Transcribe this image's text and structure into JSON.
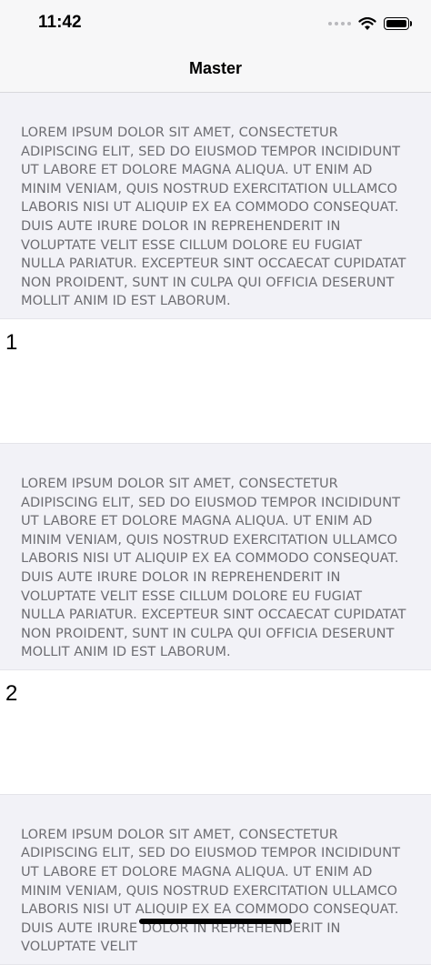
{
  "status": {
    "time": "11:42"
  },
  "nav": {
    "title": "Master"
  },
  "sections": [
    {
      "header": "LOREM IPSUM DOLOR SIT AMET, CONSECTETUR ADIPISCING ELIT, SED DO EIUSMOD TEMPOR INCIDIDUNT UT LABORE ET DOLORE MAGNA ALIQUA. UT ENIM AD MINIM VENIAM, QUIS NOSTRUD EXERCITATION ULLAMCO LABORIS NISI UT ALIQUIP EX EA COMMODO CONSEQUAT. DUIS AUTE IRURE DOLOR IN REPREHENDERIT IN VOLUPTATE VELIT ESSE CILLUM DOLORE EU FUGIAT NULLA PARIATUR. EXCEPTEUR SINT OCCAECAT CUPIDATAT NON PROIDENT, SUNT IN CULPA QUI OFFICIA DESERUNT MOLLIT ANIM ID EST LABORUM.",
      "cell": "1"
    },
    {
      "header": "LOREM IPSUM DOLOR SIT AMET, CONSECTETUR ADIPISCING ELIT, SED DO EIUSMOD TEMPOR INCIDIDUNT UT LABORE ET DOLORE MAGNA ALIQUA. UT ENIM AD MINIM VENIAM, QUIS NOSTRUD EXERCITATION ULLAMCO LABORIS NISI UT ALIQUIP EX EA COMMODO CONSEQUAT. DUIS AUTE IRURE DOLOR IN REPREHENDERIT IN VOLUPTATE VELIT ESSE CILLUM DOLORE EU FUGIAT NULLA PARIATUR. EXCEPTEUR SINT OCCAECAT CUPIDATAT NON PROIDENT, SUNT IN CULPA QUI OFFICIA DESERUNT MOLLIT ANIM ID EST LABORUM.",
      "cell": "2"
    },
    {
      "header": "LOREM IPSUM DOLOR SIT AMET, CONSECTETUR ADIPISCING ELIT, SED DO EIUSMOD TEMPOR INCIDIDUNT UT LABORE ET DOLORE MAGNA ALIQUA. UT ENIM AD MINIM VENIAM, QUIS NOSTRUD EXERCITATION ULLAMCO LABORIS NISI UT ALIQUIP EX EA COMMODO CONSEQUAT. DUIS AUTE IRURE DOLOR IN REPREHENDERIT IN VOLUPTATE VELIT"
    }
  ],
  "icons": {
    "cellular": "cellular-dots-icon",
    "wifi": "wifi-icon",
    "battery": "battery-icon"
  }
}
